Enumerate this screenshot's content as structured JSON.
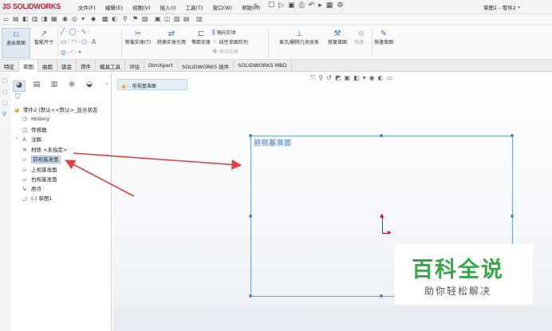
{
  "app": {
    "logo_prefix": "3S",
    "logo_text": "SOLIDWORKS",
    "menu": [
      "文件(F)",
      "编辑(E)",
      "视图(V)",
      "插入(I)",
      "工具(T)",
      "窗口(W)",
      "帮助(H)"
    ],
    "doc_title": "草图1 - 零件2 *"
  },
  "command_manager": {
    "exit_sketch": "退出草图",
    "smart_dimension": "智能尺寸",
    "trim": "剪裁实体(T)",
    "convert": "转换实体引用",
    "offset": "等距实体",
    "mirror": "镜向实体",
    "linear_pattern": "线性草图阵列",
    "move": "移动实体",
    "relations": "显示/删除几何关系",
    "repair": "修复草图",
    "quick_snaps_dim": "快速...",
    "rapid_sketch": "快速草图"
  },
  "tabs": [
    "特征",
    "草图",
    "曲面",
    "钣金",
    "焊件",
    "模具工具",
    "评估",
    "DimXpert",
    "SOLIDWORKS 插件",
    "SOLIDWORKS MBD"
  ],
  "active_tab": "草图",
  "tree": {
    "root": "零件2 (默认<<默认>_显示状态",
    "items": [
      {
        "label": "History",
        "icon": "history-icon"
      },
      {
        "label": "传感器",
        "icon": "sensor-icon"
      },
      {
        "label": "注解",
        "icon": "annotation-icon"
      },
      {
        "label": "材质 <未指定>",
        "icon": "material-icon"
      },
      {
        "label": "前视基准面",
        "icon": "plane-icon",
        "selected": true
      },
      {
        "label": "上视基准面",
        "icon": "plane-icon"
      },
      {
        "label": "右视基准面",
        "icon": "plane-icon"
      },
      {
        "label": "原点",
        "icon": "origin-icon"
      },
      {
        "label": "(-) 草图1",
        "icon": "sketch-icon"
      }
    ]
  },
  "breadcrumb": "前视基准面",
  "plane_label": "前视基准面",
  "watermark": {
    "title": "百科全说",
    "subtitle": "助你轻松解决"
  },
  "colors": {
    "accent": "#3b6fb6",
    "plane": "#6fa3d8",
    "arrow": "#e04040",
    "watermark_green": "#3aa64a",
    "origin": "#c8102e"
  }
}
